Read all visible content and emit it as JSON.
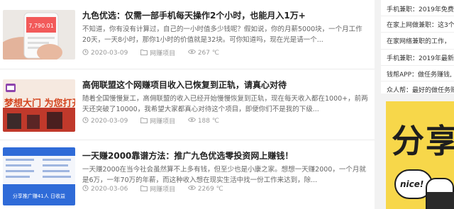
{
  "articles": [
    {
      "title": "九色优选：仅需一部手机每天操作2个小时，也能月入1万+",
      "excerpt": "不知道，你有没有计算过，自己的一小时值多少钱呢？假如说，你的月薪5000块，一个月工作20天，一天8小时，那你1小时的价值就是32块。可你知道吗，现在光是请一个...",
      "date": "2020-03-09",
      "category": "网赚项目",
      "views": "267 ℃",
      "thumb_text": "7,790.01"
    },
    {
      "title": "高佣联盟这个网赚项目收入已恢复到正轨，请真心对待",
      "excerpt": "随着全国慢慢复工，高佣联盟的收入已经开始慢慢恢复到正轨，现在每天收入都在1000+，前两天还突破了10000，我希望大家都真心对待这个项目，即便你们不是我的下级...",
      "date": "2020-03-09",
      "category": "网赚项目",
      "views": "188 ℃",
      "thumb_text": "梦想大门 为您打开"
    },
    {
      "title": "一天赚2000靠谱方法：推广九色优选零投资网上赚钱！",
      "excerpt": "一天赚2000在当今社会虽然算不上多有钱，但至少也是小康之家。想想一天赚2000，一个月就是6万，一年70万的年薪，而这种收入想在现实生活中找一份工作来达到，除...",
      "date": "2020-03-06",
      "category": "网赚项目",
      "views": "2269 ℃",
      "thumb_text": "分享推广赚41人 日收益"
    }
  ],
  "sidebar": {
    "items": [
      "手机兼职：2019年免费",
      "在家上网做兼职：这3个",
      "在家网络兼职的工作，",
      "手机兼职：2019年最新",
      "钱帮APP：做任务赚钱,",
      "众人帮：最好的做任务赚"
    ]
  },
  "ad": {
    "headline": "分享",
    "bubble": "nice!"
  },
  "colors": {
    "ad_bg": "#f7d74a",
    "thumb1": "#f25a5a",
    "thumb2": "#c0392b",
    "thumb3": "#2f6bd8"
  }
}
